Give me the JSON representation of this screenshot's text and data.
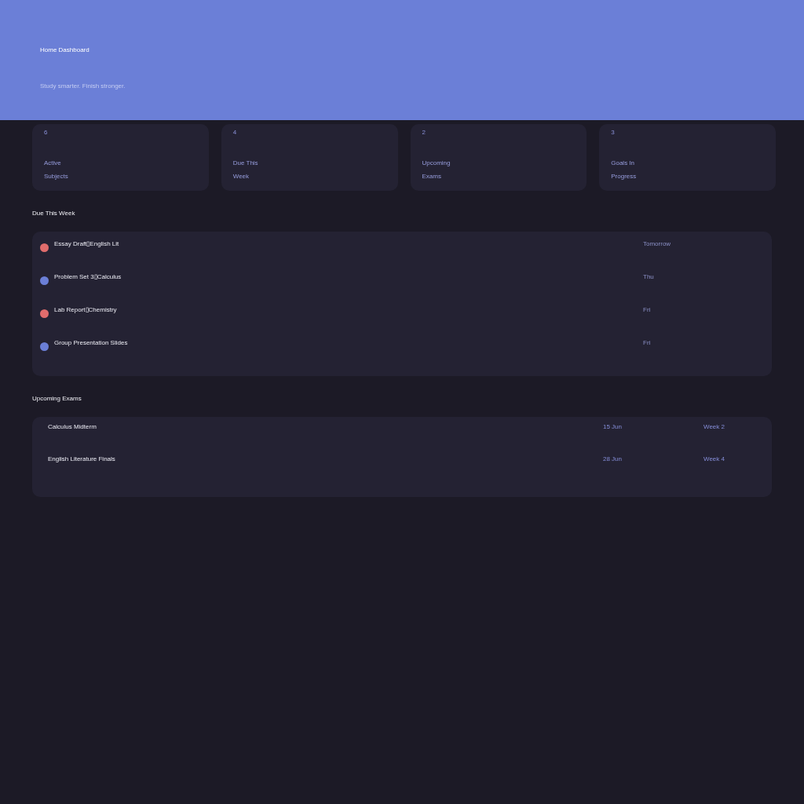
{
  "header": {
    "title": "Home Dashboard",
    "subtitle": "Study smarter. Finish stronger."
  },
  "stats": [
    {
      "value": "6",
      "label": "Active Subjects"
    },
    {
      "value": "4",
      "label": "Due This Week"
    },
    {
      "value": "2",
      "label": "Upcoming Exams"
    },
    {
      "value": "3",
      "label": "Goals In Progress"
    }
  ],
  "due_this_week": {
    "heading": "Due This Week",
    "items": [
      {
        "title": "Essay Draft▯English Lit",
        "due": "Tomorrow",
        "color": "#e06c6c"
      },
      {
        "title": "Problem Set 3▯Calculus",
        "due": "Thu",
        "color": "#6b7fd7"
      },
      {
        "title": "Lab Report▯Chemistry",
        "due": "Fri",
        "color": "#e06c6c"
      },
      {
        "title": "Group Presentation Slides",
        "due": "Fri",
        "color": "#6b7fd7"
      }
    ]
  },
  "upcoming_exams": {
    "heading": "Upcoming Exams",
    "exams": [
      {
        "name": "Calculus Midterm",
        "date": "15 Jun",
        "week": "Week 2"
      },
      {
        "name": "English Literature Finals",
        "date": "28 Jun",
        "week": "Week 4"
      }
    ]
  }
}
